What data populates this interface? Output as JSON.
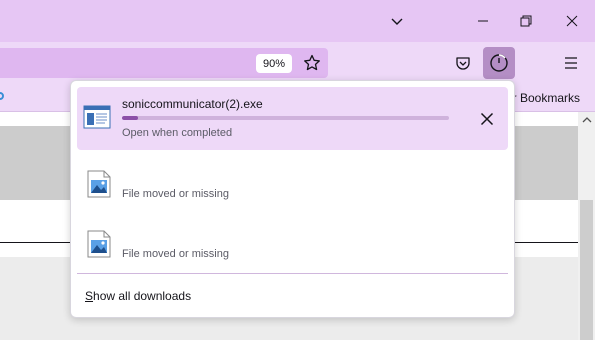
{
  "window": {
    "controls": [
      "chevron-down-icon",
      "minimize-icon",
      "restore-icon",
      "close-icon"
    ]
  },
  "toolbar": {
    "zoom_label": "90%",
    "icons": [
      "star-icon",
      "pocket-icon",
      "downloads-icon",
      "menu-icon"
    ]
  },
  "bookmarks": {
    "other_label": "er Bookmarks"
  },
  "downloads_panel": {
    "items": [
      {
        "filename": "soniccommunicator(2).exe",
        "status": "Open when completed",
        "progress": 0.05,
        "icon": "exe-file-icon"
      },
      {
        "filename": "",
        "status": "File moved or missing",
        "icon": "image-file-icon"
      },
      {
        "filename": "",
        "status": "File moved or missing",
        "icon": "image-file-icon"
      }
    ],
    "show_all_first": "S",
    "show_all_rest": "how all downloads"
  },
  "colors": {
    "titlebar": "#e6c6f4",
    "toolbar": "#eed9f8",
    "active_item": "#eed9f8",
    "progress": "#8c4fa8"
  }
}
